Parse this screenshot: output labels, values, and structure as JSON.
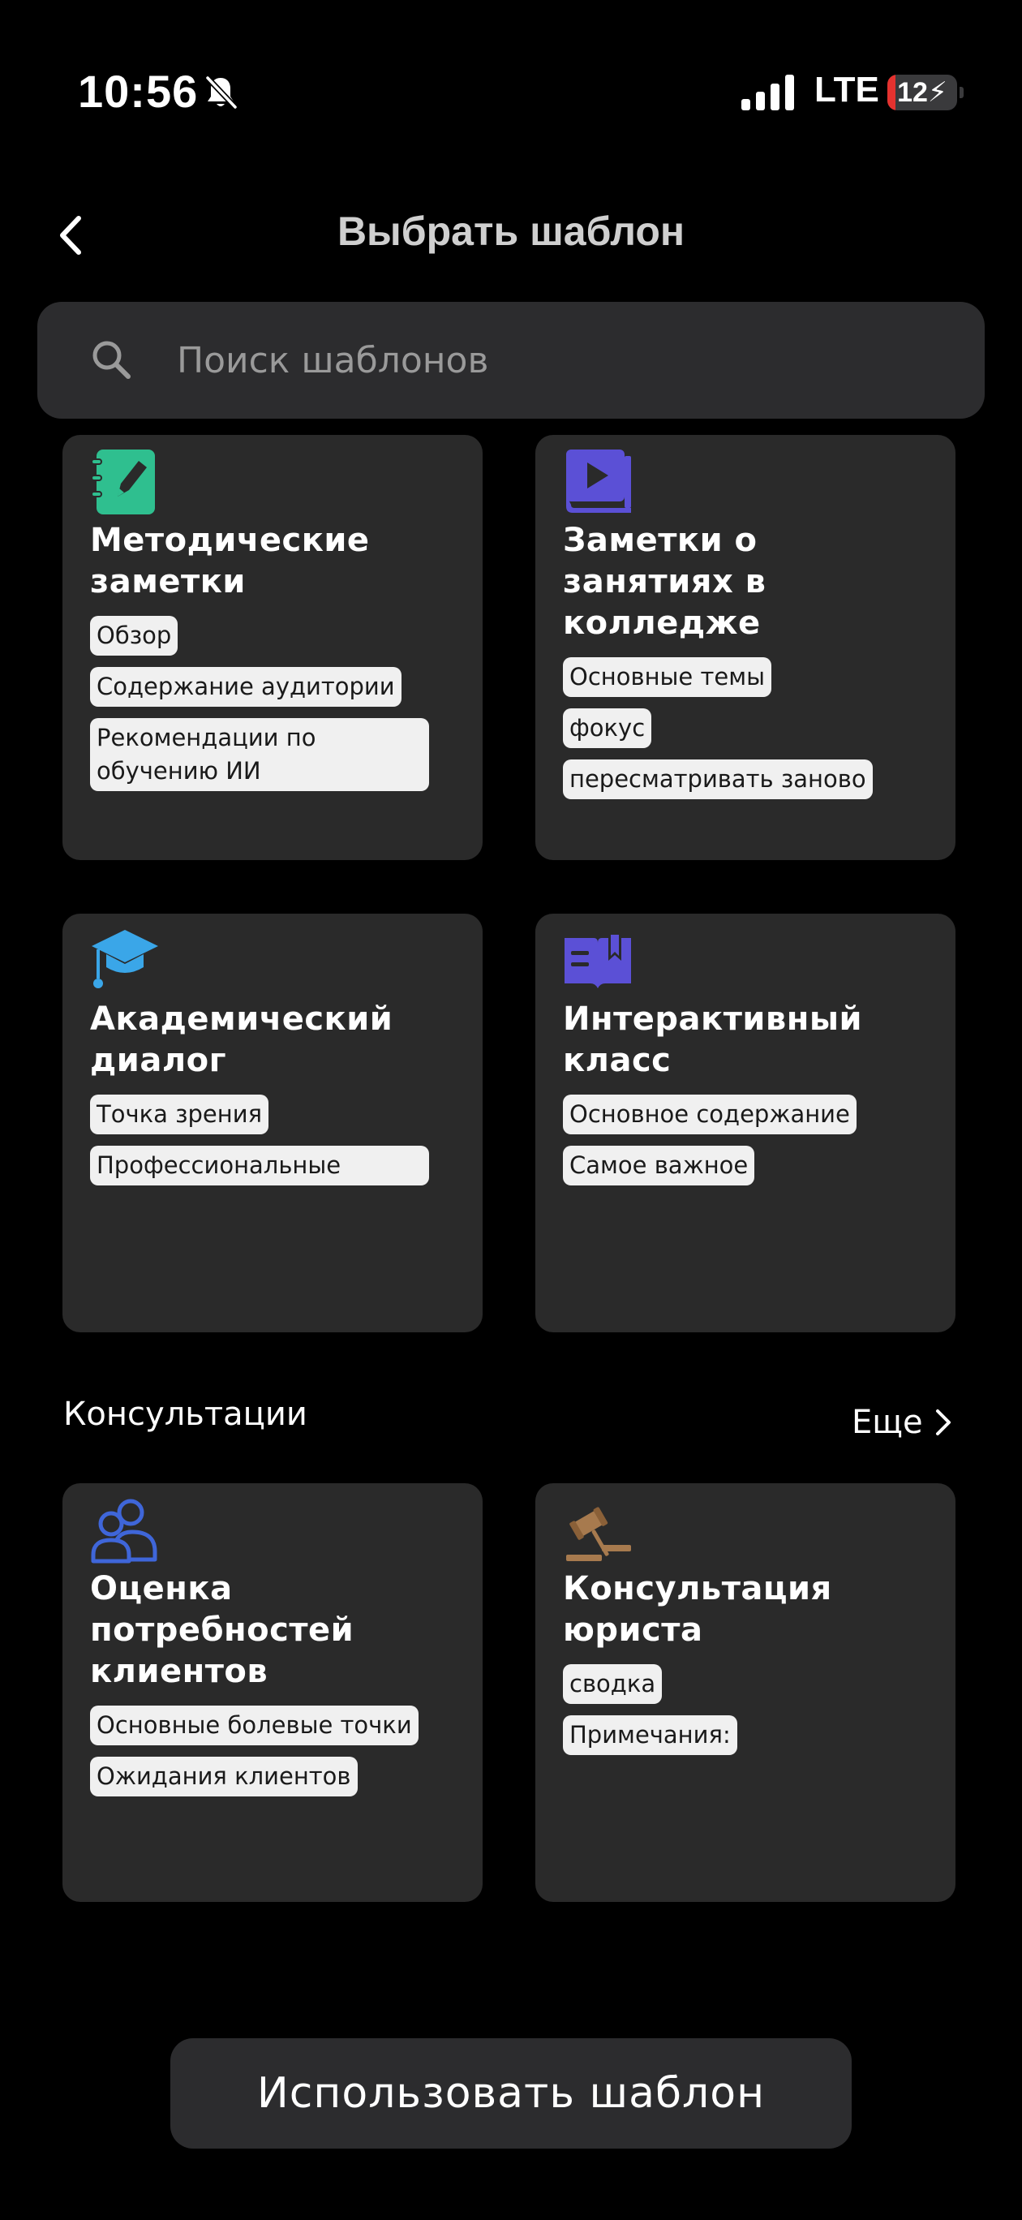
{
  "status_bar": {
    "time": "10:56",
    "network": "LTE",
    "battery_level": "12",
    "battery_fraction": 0.12,
    "icons": [
      "bell-slash-icon",
      "signal-icon",
      "battery-charging-icon"
    ]
  },
  "header": {
    "title": "Выбрать шаблон",
    "back_icon": "chevron-left-icon"
  },
  "search": {
    "placeholder": "Поиск шаблонов",
    "value": "",
    "icon": "search-icon"
  },
  "templates": [
    {
      "title": "Методические заметки",
      "icon": "notebook-pencil-icon",
      "icon_color": "#2fbf8f",
      "tags": [
        "Обзор",
        "Содержание аудитории",
        "Рекомендации по обучению ИИ"
      ]
    },
    {
      "title": "Заметки о занятиях в колледже",
      "icon": "video-book-icon",
      "icon_color": "#5b50d6",
      "tags": [
        "Основные темы",
        "фокус",
        "пересматривать заново"
      ]
    },
    {
      "title": "Академический диалог",
      "icon": "graduation-cap-icon",
      "icon_color": "#3aa6e8",
      "tags": [
        "Точка зрения",
        "Профессиональные"
      ]
    },
    {
      "title": "Интерактивный класс",
      "icon": "open-book-icon",
      "icon_color": "#5b50d6",
      "tags": [
        "Основное содержание",
        "Самое важное"
      ]
    }
  ],
  "consult_section": {
    "title": "Консультации",
    "more_label": "Еще",
    "more_icon": "chevron-right-icon",
    "templates": [
      {
        "title": "Оценка потребностей клиентов",
        "icon": "users-icon",
        "icon_color": "#3f66d9",
        "tags": [
          "Основные болевые точки",
          "Ожидания клиентов"
        ]
      },
      {
        "title": "Консультация юриста",
        "icon": "gavel-icon",
        "icon_color": "#a77a4e",
        "tags": [
          "сводка",
          "Примечания:"
        ]
      }
    ]
  },
  "footer": {
    "use_button_label": "Использовать шаблон"
  }
}
